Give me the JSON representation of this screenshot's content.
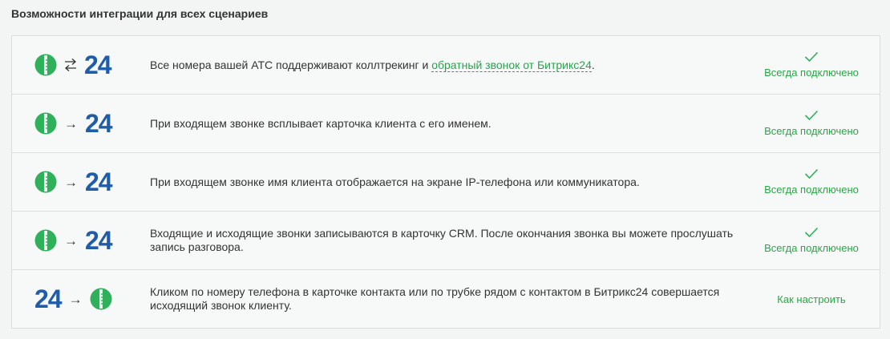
{
  "section_title": "Возможности интеграции для всех сценариев",
  "brand": {
    "b24_label": "24",
    "accent_green": "#2fb05a",
    "b24_blue": "#1f5da8"
  },
  "rows": [
    {
      "icon_left": "pbx-icon",
      "connector": "swap-arrows-icon",
      "icon_right": "bitrix24-logo",
      "text_before": "Все номера вашей АТС поддерживают коллтрекинг и ",
      "link_text": "обратный звонок от Битрикс24",
      "text_after": ".",
      "status": "Всегда подключено"
    },
    {
      "icon_left": "pbx-icon",
      "connector": "→",
      "icon_right": "bitrix24-logo",
      "text": "При входящем звонке всплывает карточка клиента с его именем.",
      "status": "Всегда подключено"
    },
    {
      "icon_left": "pbx-icon",
      "connector": "→",
      "icon_right": "bitrix24-logo",
      "text": "При входящем звонке имя клиента отображается на экране IP-телефона или коммуникатора.",
      "status": "Всегда подключено"
    },
    {
      "icon_left": "pbx-icon",
      "connector": "→",
      "icon_right": "bitrix24-logo",
      "text": "Входящие и исходящие звонки записываются в карточку CRM. После окончания звонка вы можете прослушать запись разговора.",
      "status": "Всегда подключено"
    },
    {
      "icon_left": "bitrix24-logo",
      "connector": "→",
      "icon_right": "pbx-icon",
      "text": "Кликом по номеру телефона в карточке контакта или по трубке рядом с контактом в Битрикс24 совершается исходящий звонок клиенту.",
      "action": "Как настроить"
    }
  ]
}
